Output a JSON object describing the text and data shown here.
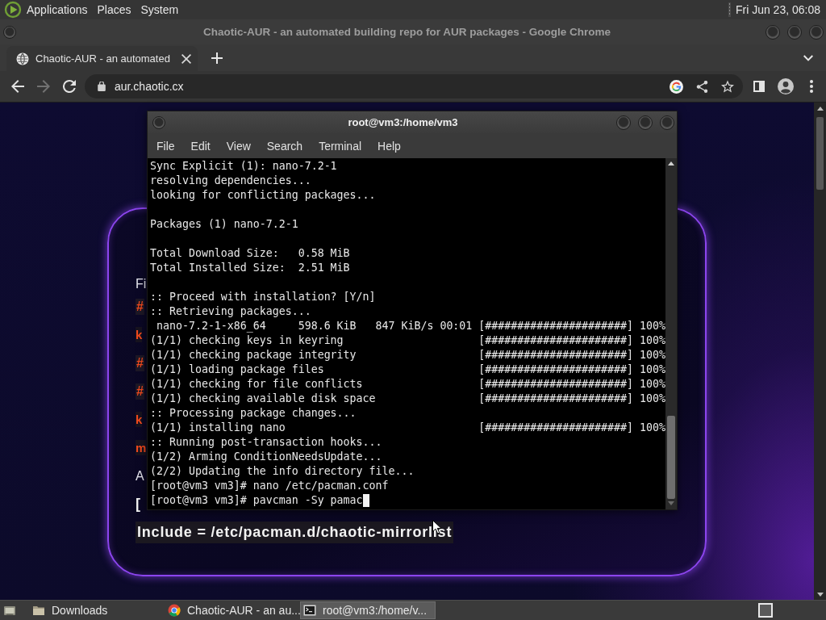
{
  "top_panel": {
    "menus": [
      "Applications",
      "Places",
      "System"
    ],
    "clock": "Fri Jun 23, 06:08"
  },
  "browser": {
    "window_title": "Chaotic-AUR - an automated building repo for AUR packages - Google Chrome",
    "tabs": [
      {
        "title": "Chaotic-AUR - an automated",
        "selected": true
      }
    ],
    "nav_buttons": [
      {
        "kind": "back",
        "disabled": false
      },
      {
        "kind": "forward",
        "disabled": true
      },
      {
        "kind": "reload",
        "disabled": false
      }
    ],
    "address": "aur.chaotic.cx",
    "page": {
      "lines": [
        {
          "kind": "text",
          "text": "Fi"
        },
        {
          "kind": "comment",
          "text": "#"
        },
        {
          "kind": "keyword",
          "text": "k"
        },
        {
          "kind": "comment",
          "text": "#"
        },
        {
          "kind": "comment",
          "text": "#"
        },
        {
          "kind": "keyword",
          "text": "k"
        },
        {
          "kind": "keyword",
          "text": "m"
        },
        {
          "kind": "text",
          "text": "A"
        },
        {
          "kind": "heading",
          "text": "["
        },
        {
          "kind": "code",
          "text": "Include = /etc/pacman.d/chaotic-mirrorlist"
        }
      ]
    }
  },
  "terminal": {
    "title": "root@vm3:/home/vm3",
    "menu": [
      "File",
      "Edit",
      "View",
      "Search",
      "Terminal",
      "Help"
    ],
    "blocks": [
      [
        "Sync Explicit (1): nano-7.2-1",
        "resolving dependencies...",
        "looking for conflicting packages..."
      ],
      [
        "Packages (1) nano-7.2-1"
      ],
      [
        "Total Download Size:   0.58 MiB",
        "Total Installed Size:  2.51 MiB"
      ],
      [
        ":: Proceed with installation? [Y/n]",
        ":: Retrieving packages...",
        " nano-7.2-1-x86_64     598.6 KiB   847 KiB/s 00:01 [######################] 100%",
        "(1/1) checking keys in keyring                     [######################] 100%",
        "(1/1) checking package integrity                   [######################] 100%",
        "(1/1) loading package files                        [######################] 100%",
        "(1/1) checking for file conflicts                  [######################] 100%",
        "(1/1) checking available disk space                [######################] 100%",
        ":: Processing package changes...",
        "(1/1) installing nano                              [######################] 100%",
        ":: Running post-transaction hooks...",
        "(1/2) Arming ConditionNeedsUpdate...",
        "(2/2) Updating the info directory file...",
        "[root@vm3 vm3]# nano /etc/pacman.conf",
        "[root@vm3 vm3]# pavcman -Sy pamac"
      ]
    ]
  },
  "taskbar": {
    "items": [
      {
        "kind": "folder",
        "label": "Downloads",
        "selected": false
      },
      {
        "kind": "browser",
        "label": "Chaotic-AUR - an au...",
        "selected": false
      },
      {
        "kind": "terminal",
        "label": "root@vm3:/home/v...",
        "selected": true
      }
    ]
  }
}
